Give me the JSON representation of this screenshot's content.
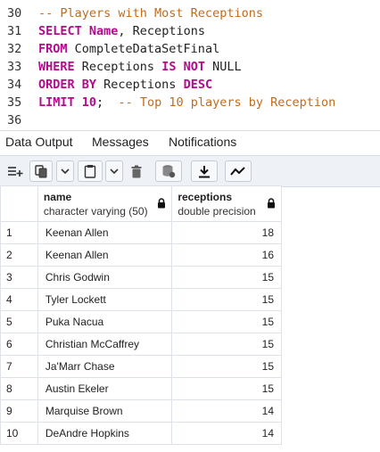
{
  "editor": {
    "lines": [
      {
        "num": "30",
        "parts": [
          {
            "t": "-- Players with Most Receptions",
            "c": "cm"
          }
        ]
      },
      {
        "num": "31",
        "parts": [
          {
            "t": "SELECT ",
            "c": "kw"
          },
          {
            "t": "Name",
            "c": "kw"
          },
          {
            "t": ", Receptions",
            "c": "id"
          }
        ]
      },
      {
        "num": "32",
        "parts": [
          {
            "t": "FROM ",
            "c": "kw"
          },
          {
            "t": "CompleteDataSetFinal",
            "c": "id"
          }
        ]
      },
      {
        "num": "33",
        "parts": [
          {
            "t": "WHERE ",
            "c": "kw"
          },
          {
            "t": "Receptions ",
            "c": "id"
          },
          {
            "t": "IS NOT ",
            "c": "kw"
          },
          {
            "t": "NULL",
            "c": "id"
          }
        ]
      },
      {
        "num": "34",
        "parts": [
          {
            "t": "ORDER BY ",
            "c": "kw"
          },
          {
            "t": "Receptions ",
            "c": "id"
          },
          {
            "t": "DESC",
            "c": "kw"
          }
        ]
      },
      {
        "num": "35",
        "parts": [
          {
            "t": "LIMIT ",
            "c": "kw"
          },
          {
            "t": "10",
            "c": "num"
          },
          {
            "t": ";  ",
            "c": "id"
          },
          {
            "t": "-- Top 10 players by Reception",
            "c": "cm"
          }
        ]
      },
      {
        "num": "36",
        "parts": []
      }
    ]
  },
  "tabs": [
    {
      "label": "Data Output",
      "active": true
    },
    {
      "label": "Messages",
      "active": false
    },
    {
      "label": "Notifications",
      "active": false
    }
  ],
  "toolbar": {
    "icons": [
      "add-row-icon",
      "copy-icon",
      "chevron-down-icon",
      "paste-icon",
      "chevron-down-icon",
      "delete-icon",
      "save-data-icon",
      "download-icon",
      "graph-icon"
    ]
  },
  "grid": {
    "columns": [
      {
        "name": "name",
        "type": "character varying (50)"
      },
      {
        "name": "receptions",
        "type": "double precision"
      }
    ],
    "rows": [
      {
        "n": "1",
        "name": "Keenan Allen",
        "receptions": "18"
      },
      {
        "n": "2",
        "name": "Keenan Allen",
        "receptions": "16"
      },
      {
        "n": "3",
        "name": "Chris Godwin",
        "receptions": "15"
      },
      {
        "n": "4",
        "name": "Tyler Lockett",
        "receptions": "15"
      },
      {
        "n": "5",
        "name": "Puka Nacua",
        "receptions": "15"
      },
      {
        "n": "6",
        "name": "Christian McCaffrey",
        "receptions": "15"
      },
      {
        "n": "7",
        "name": "Ja'Marr Chase",
        "receptions": "15"
      },
      {
        "n": "8",
        "name": "Austin Ekeler",
        "receptions": "15"
      },
      {
        "n": "9",
        "name": "Marquise Brown",
        "receptions": "14"
      },
      {
        "n": "10",
        "name": "DeAndre Hopkins",
        "receptions": "14"
      }
    ]
  }
}
